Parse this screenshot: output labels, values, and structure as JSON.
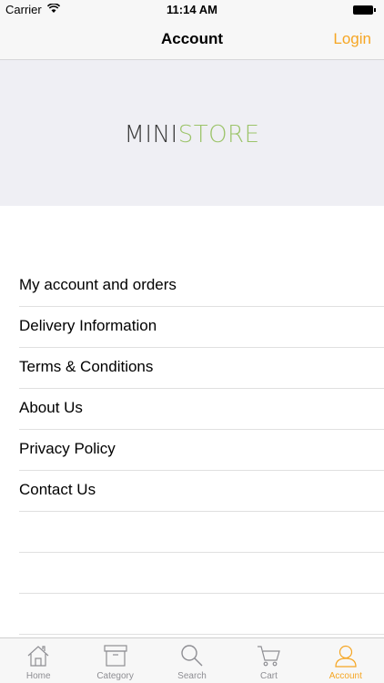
{
  "status": {
    "carrier": "Carrier",
    "time": "11:14 AM"
  },
  "nav": {
    "title": "Account",
    "login": "Login"
  },
  "logo": {
    "mini": "MINI",
    "store": "STORE"
  },
  "menu": [
    {
      "label": "My account and orders"
    },
    {
      "label": "Delivery Information"
    },
    {
      "label": "Terms & Conditions"
    },
    {
      "label": "About Us"
    },
    {
      "label": "Privacy Policy"
    },
    {
      "label": "Contact Us"
    }
  ],
  "tabs": [
    {
      "label": "Home",
      "icon": "home-icon"
    },
    {
      "label": "Category",
      "icon": "box-icon"
    },
    {
      "label": "Search",
      "icon": "search-icon"
    },
    {
      "label": "Cart",
      "icon": "cart-icon"
    },
    {
      "label": "Account",
      "icon": "person-icon",
      "active": true
    }
  ],
  "colors": {
    "accent": "#f6a623",
    "logo_green": "#9cc46a",
    "banner_bg": "#efeff4"
  }
}
